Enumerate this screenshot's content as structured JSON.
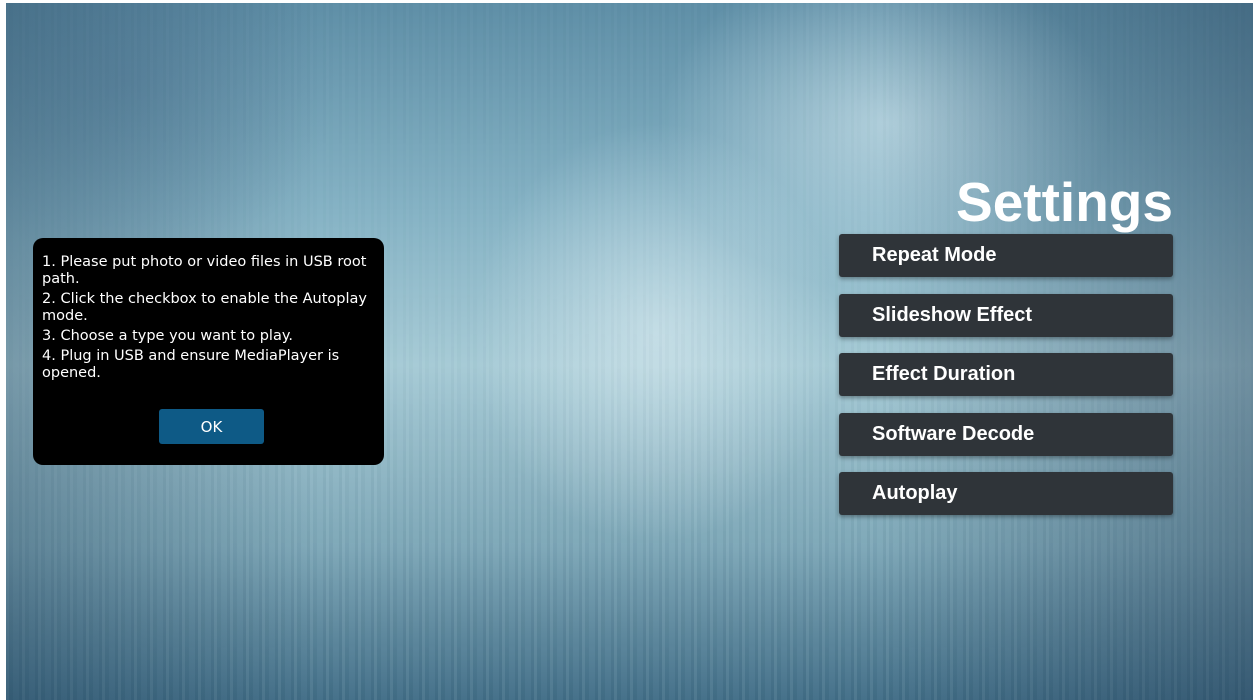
{
  "dialog": {
    "lines": [
      "1. Please put photo or video files in USB root path.",
      "2. Click the checkbox to enable the Autoplay mode.",
      "3. Choose a type you want to play.",
      "4. Plug in USB and ensure MediaPlayer is opened."
    ],
    "ok_label": "OK"
  },
  "settings": {
    "title": "Settings",
    "items": [
      {
        "label": "Repeat Mode"
      },
      {
        "label": "Slideshow Effect"
      },
      {
        "label": "Effect Duration"
      },
      {
        "label": "Software Decode"
      },
      {
        "label": "Autoplay"
      }
    ]
  },
  "colors": {
    "dialog_bg": "#000000",
    "ok_button": "#0e5a86",
    "menu_item_bg": "#2f3439",
    "text": "#ffffff"
  }
}
